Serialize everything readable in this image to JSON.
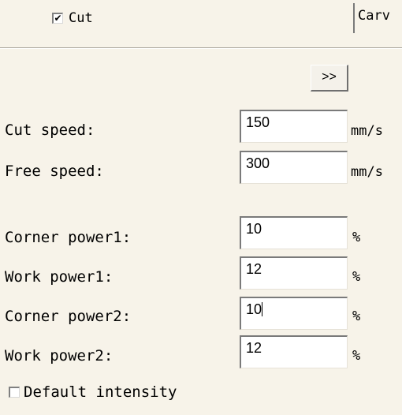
{
  "cut_checkbox": {
    "label": "Cut",
    "checked": true,
    "mark": "✔"
  },
  "carve_tab": {
    "label": "Carv"
  },
  "expand_button": {
    "label": ">>"
  },
  "speeds": [
    {
      "label": "Cut speed:",
      "value": "150",
      "unit": "mm/s"
    },
    {
      "label": "Free speed:",
      "value": "300",
      "unit": "mm/s"
    }
  ],
  "powers": [
    {
      "label": "Corner power1:",
      "value": "10",
      "unit": "%"
    },
    {
      "label": "Work power1:",
      "value": "12",
      "unit": "%"
    },
    {
      "label": "Corner power2:",
      "value": "10",
      "unit": "%"
    },
    {
      "label": "Work power2:",
      "value": "12",
      "unit": "%"
    }
  ],
  "default_intensity": {
    "label": "Default intensity",
    "checked": false
  }
}
